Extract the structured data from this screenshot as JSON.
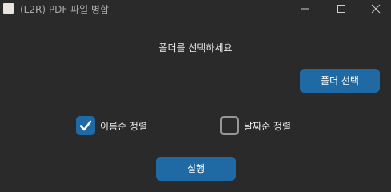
{
  "window": {
    "title": "(L2R) PDF 파일 병합",
    "controls": {
      "minimize_icon": "minimize-icon",
      "maximize_icon": "maximize-icon",
      "close_icon": "close-icon"
    }
  },
  "main": {
    "prompt": "폴더를 선택하세요",
    "select_folder_button": "폴더 선택",
    "options": [
      {
        "label": "이름순 정렬",
        "checked": true
      },
      {
        "label": "날짜순 정렬",
        "checked": false
      }
    ],
    "run_button": "실행"
  },
  "colors": {
    "accent": "#1f6aa5",
    "background": "#2a2a2a",
    "text": "#ececec",
    "checkbox_border": "#969696"
  }
}
